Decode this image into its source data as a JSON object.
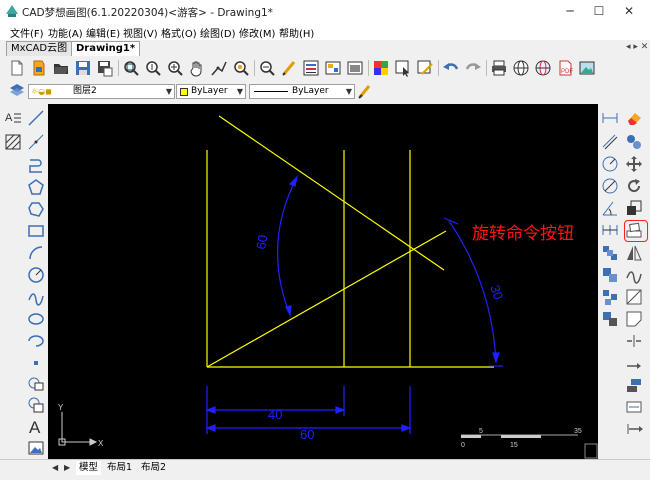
{
  "window": {
    "title": "CAD梦想画图(6.1.20220304)<游客> - Drawing1*",
    "minimize": "─",
    "maximize": "☐",
    "close": "✕"
  },
  "menu": [
    "文件(F)",
    "功能(A)",
    "编辑(E)",
    "视图(V)",
    "格式(O)",
    "绘图(D)",
    "修改(M)",
    "帮助(H)"
  ],
  "tabs": [
    "MxCAD云图",
    "Drawing1*"
  ],
  "tab_controls": "◂ ▸ ✕",
  "layer_toolbar": {
    "layer_name": "图层2",
    "color": "ByLayer",
    "linetype": "ByLayer"
  },
  "drawing": {
    "dim_angle_left": "60",
    "dim_angle_right": "30",
    "dim_len_short": "40",
    "dim_len_long": "60",
    "scale_top": [
      "5",
      "35"
    ],
    "scale_bottom": [
      "0",
      "15"
    ],
    "ucs_y": "Y",
    "ucs_x": "X"
  },
  "annotation": "旋转命令按钮",
  "layout_tabs": [
    "模型",
    "布局1",
    "布局2"
  ],
  "colors": {
    "geometry": "#ffff00",
    "dimension": "#0000ff",
    "annotation": "#ff1414",
    "canvas": "#000000"
  }
}
